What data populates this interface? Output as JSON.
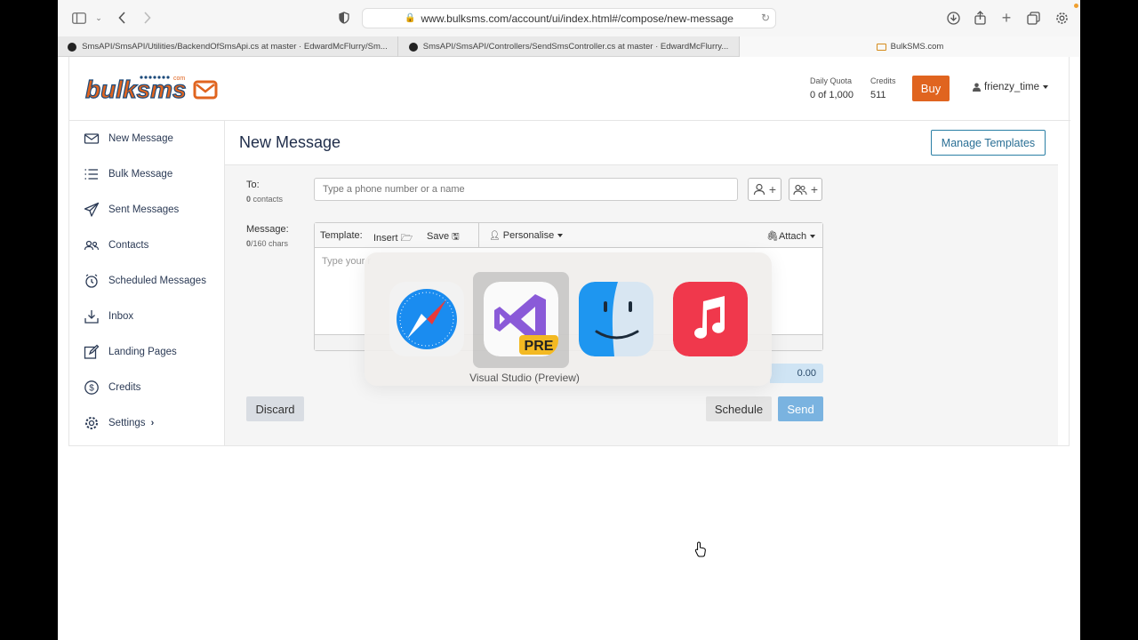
{
  "browser": {
    "url": "www.bulksms.com/account/ui/index.html#/compose/new-message",
    "tabs": [
      {
        "title": "SmsAPI/SmsAPI/Utilities/BackendOfSmsApi.cs at master · EdwardMcFlurry/Sm..."
      },
      {
        "title": "SmsAPI/SmsAPI/Controllers/SendSmsController.cs at master · EdwardMcFlurry..."
      },
      {
        "title": "BulkSMS.com"
      }
    ]
  },
  "header": {
    "logo_text": "bulksms",
    "logo_sub": "com",
    "daily_quota_label": "Daily Quota",
    "daily_quota_value": "0 of 1,000",
    "credits_label": "Credits",
    "credits_value": "511",
    "buy_label": "Buy",
    "username": "frienzy_time"
  },
  "sidebar": {
    "items": [
      {
        "label": "New Message",
        "icon": "envelope-icon"
      },
      {
        "label": "Bulk Message",
        "icon": "list-icon"
      },
      {
        "label": "Sent Messages",
        "icon": "paper-plane-icon"
      },
      {
        "label": "Contacts",
        "icon": "contacts-icon"
      },
      {
        "label": "Scheduled Messages",
        "icon": "alarm-clock-icon"
      },
      {
        "label": "Inbox",
        "icon": "download-icon"
      },
      {
        "label": "Landing Pages",
        "icon": "edit-icon"
      },
      {
        "label": "Credits",
        "icon": "dollar-circle-icon"
      },
      {
        "label": "Settings",
        "icon": "gear-icon"
      }
    ]
  },
  "main": {
    "title": "New Message",
    "manage_templates_label": "Manage Templates",
    "to_label": "To:",
    "contacts_count": "0",
    "contacts_suffix": " contacts",
    "to_placeholder": "Type a phone number or a name",
    "message_label": "Message:",
    "chars_count": "0",
    "chars_suffix": "/160 chars",
    "toolbar": {
      "template_label": "Template:",
      "insert_label": "Insert",
      "save_label": "Save",
      "personalise_label": "Personalise",
      "attach_label": "Attach"
    },
    "message_placeholder": "Type your r",
    "cost_value": "0.00",
    "discard_label": "Discard",
    "schedule_label": "Schedule",
    "send_label": "Send"
  },
  "app_switcher": {
    "apps": [
      "Safari",
      "Visual Studio (Preview)",
      "Finder",
      "Music"
    ],
    "selected_label": "Visual Studio (Preview)",
    "badge": "PRE"
  },
  "colors": {
    "accent_orange": "#e0641f",
    "primary_blue": "#2a7fa5",
    "send_blue": "#7ab3e0",
    "nav_text": "#2b3a55"
  }
}
